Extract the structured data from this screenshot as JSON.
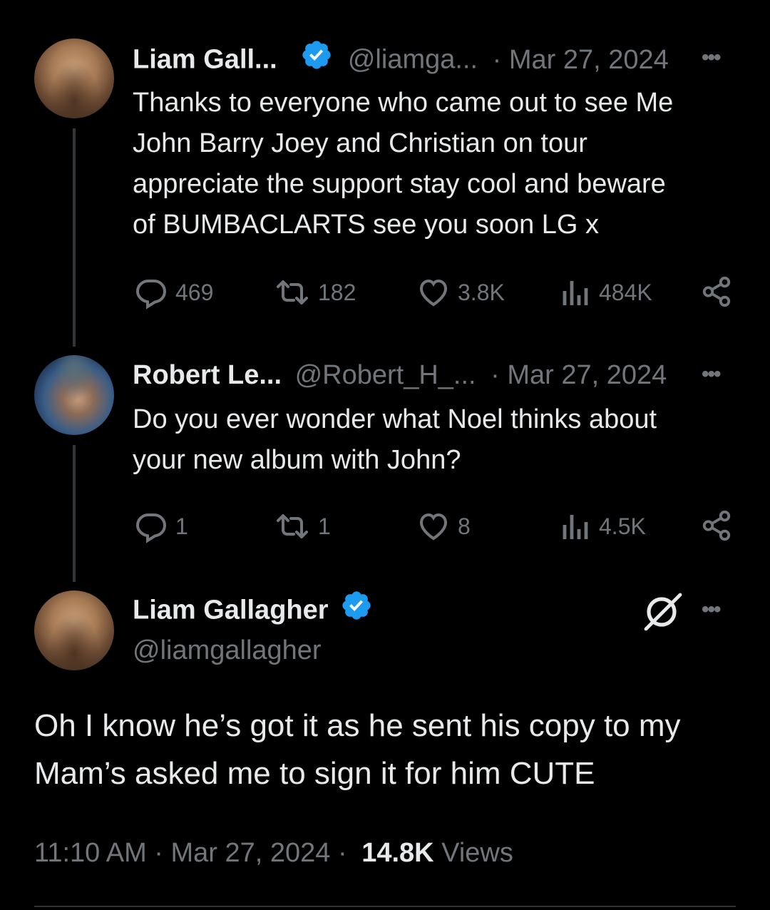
{
  "thread": [
    {
      "name": "Liam Gall...",
      "handle": "@liamga...",
      "date": "· Mar 27, 2024",
      "text_lines": [
        "Thanks to everyone who came out to see Me",
        "John Barry Joey and Christian on tour",
        "appreciate the support stay cool and beware",
        "of BUMBACLARTS see you soon LG x"
      ],
      "replies": "469",
      "reposts": "182",
      "likes": "3.8K",
      "views": "484K"
    },
    {
      "name": "Robert Le...",
      "handle": "@Robert_H_...",
      "date": "· Mar 27, 2024",
      "text_lines": [
        "Do you ever wonder what Noel thinks about",
        "your new album with John?"
      ],
      "replies": "1",
      "reposts": "1",
      "likes": "8",
      "views": "4.5K"
    }
  ],
  "main_post": {
    "name": "Liam Gallagher",
    "handle": "@liamgallagher",
    "text_lines": [
      "Oh I know he’s got it as he sent his copy to my",
      "Mam’s asked me to sign it for him CUTE"
    ],
    "time": "11:10 AM",
    "date": "· Mar 27, 2024 ·",
    "views_count": "14.8K",
    "views_label": "Views"
  },
  "icons": {
    "verified": "verified-badge-icon",
    "reply": "reply-icon",
    "repost": "repost-icon",
    "like": "heart-icon",
    "views": "views-icon",
    "share": "share-icon",
    "grok": "grok-icon",
    "more": "more-icon"
  },
  "colors": {
    "background": "#000000",
    "text": "#e7e9ea",
    "muted": "#71767b",
    "verified": "#1d9bf0",
    "thread_line": "#333639"
  }
}
